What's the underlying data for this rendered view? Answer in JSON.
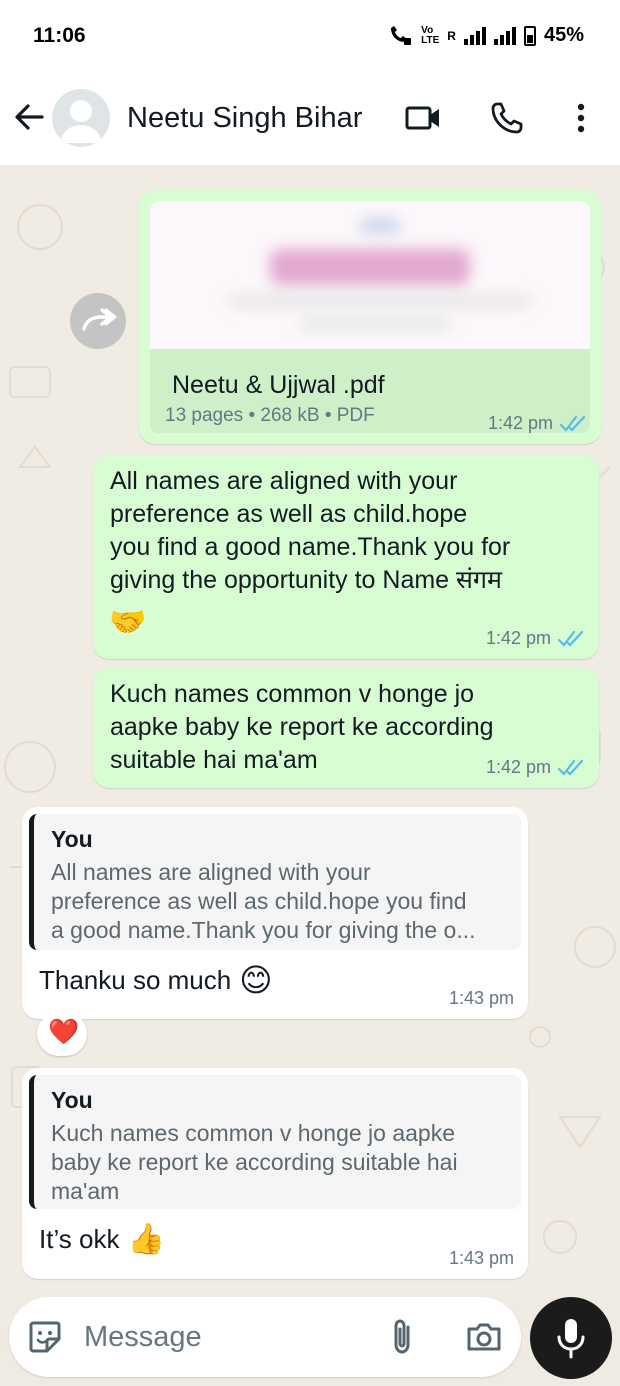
{
  "status_bar": {
    "time": "11:06",
    "network_label_top": "Vo",
    "network_label_bottom": "LTE",
    "roaming": "R",
    "battery": "45%"
  },
  "header": {
    "contact_name": "Neetu Singh Bihar",
    "icons": [
      "back-arrow-icon",
      "avatar",
      "video-call-icon",
      "voice-call-icon",
      "more-options-icon"
    ]
  },
  "messages": [
    {
      "type": "document",
      "direction": "outgoing",
      "file_name": "Neetu & Ujjwal .pdf",
      "file_meta": "13 pages • 268 kB • PDF",
      "time": "1:42 pm",
      "status": "read"
    },
    {
      "type": "text",
      "direction": "outgoing",
      "lines": [
        "All names are aligned with your",
        "preference as well as child.hope",
        "you find a good name.Thank you for",
        "giving the opportunity to Name संगम"
      ],
      "emoji": "🤝",
      "time": "1:42 pm",
      "status": "read"
    },
    {
      "type": "text",
      "direction": "outgoing",
      "lines": [
        "Kuch names common v honge jo",
        "aapke baby ke report ke according",
        "suitable hai ma'am"
      ],
      "time": "1:42 pm",
      "status": "read"
    },
    {
      "type": "reply",
      "direction": "incoming",
      "quote_author": "You",
      "quote_lines": [
        "All names are aligned with your",
        "preference as well as child.hope you find",
        "a good name.Thank you for giving the o..."
      ],
      "text": "Thanku so much",
      "emoji": "😊",
      "time": "1:43 pm",
      "reaction": "❤️"
    },
    {
      "type": "reply",
      "direction": "incoming",
      "quote_author": "You",
      "quote_lines": [
        "Kuch names common v honge jo aapke",
        "baby ke report ke according suitable hai",
        "ma'am"
      ],
      "text": "It’s okk",
      "emoji": "👍",
      "time": "1:43 pm"
    }
  ],
  "input_bar": {
    "placeholder": "Message"
  },
  "colors": {
    "outgoing_bubble": "#d9fdd3",
    "incoming_bubble": "#ffffff",
    "read_ticks": "#53bdeb",
    "chat_background": "#efeae2"
  }
}
